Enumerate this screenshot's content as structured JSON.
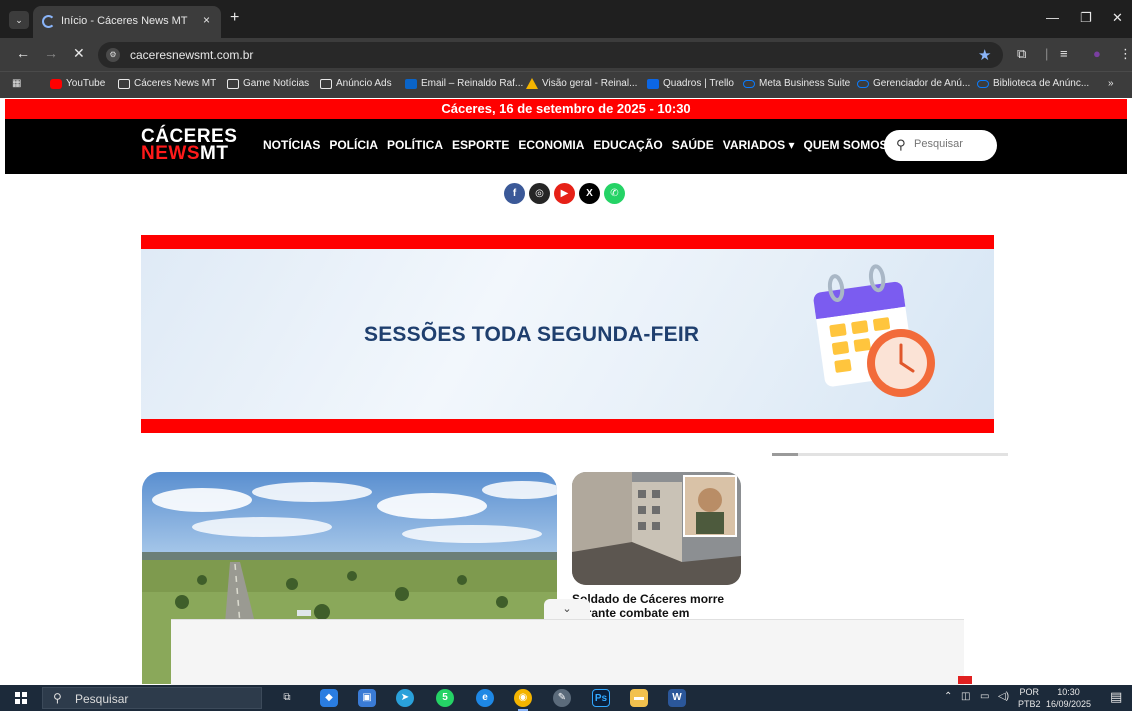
{
  "browser": {
    "tab_title": "Início - Cáceres News MT",
    "tab_close": "×",
    "new_tab": "+",
    "url": "caceresnewsmt.com.br",
    "bookmarks": [
      {
        "label": "YouTube",
        "icon": "youtube-icon"
      },
      {
        "label": "Cáceres News MT",
        "icon": "folder-icon"
      },
      {
        "label": "Game Notícias",
        "icon": "folder-icon"
      },
      {
        "label": "Anúncio Ads",
        "icon": "folder-icon"
      },
      {
        "label": "Email – Reinaldo Raf...",
        "icon": "outlook-icon"
      },
      {
        "label": "Visão geral - Reinal...",
        "icon": "google-ads-icon"
      },
      {
        "label": "Quadros | Trello",
        "icon": "trello-icon"
      },
      {
        "label": "Meta Business Suite",
        "icon": "meta-icon"
      },
      {
        "label": "Gerenciador de Anú...",
        "icon": "meta-icon"
      },
      {
        "label": "Biblioteca de Anúnc...",
        "icon": "meta-icon"
      }
    ],
    "bookmarks_overflow": "»"
  },
  "page": {
    "date_bar": "Cáceres, 16 de setembro de 2025 - 10:30",
    "logo": {
      "line1": "CÁCERES",
      "line2_red": "NEWS",
      "line2_white": "MT"
    },
    "nav": [
      "NOTÍCIAS",
      "POLÍCIA",
      "POLÍTICA",
      "ESPORTE",
      "ECONOMIA",
      "EDUCAÇÃO",
      "SAÚDE",
      "VARIADOS ▾",
      "QUEM SOMOS ▾"
    ],
    "search_placeholder": "Pesquisar",
    "socials": [
      {
        "name": "facebook",
        "glyph": "f",
        "color": "#3b5998"
      },
      {
        "name": "instagram",
        "glyph": "◎",
        "color": "#262626"
      },
      {
        "name": "youtube",
        "glyph": "▶",
        "color": "#e62117"
      },
      {
        "name": "x",
        "glyph": "X",
        "color": "#000000"
      },
      {
        "name": "whatsapp",
        "glyph": "✆",
        "color": "#25d366"
      }
    ],
    "banner_text": "SESSÕES TODA SEGUNDA-FEIR",
    "carousel_progress": 0.11,
    "small_headline": "Soldado de Cáceres morre durante combate em",
    "overlay_toggle": "⌄"
  },
  "taskbar": {
    "search_label": "Pesquisar",
    "language": "POR",
    "keyboard": "PTB2",
    "time": "10:30",
    "date": "16/09/2025",
    "whatsapp_badge": "5"
  },
  "colors": {
    "accent_red": "#ff0000",
    "header_black": "#000000",
    "banner_text": "#1f3f6e"
  }
}
